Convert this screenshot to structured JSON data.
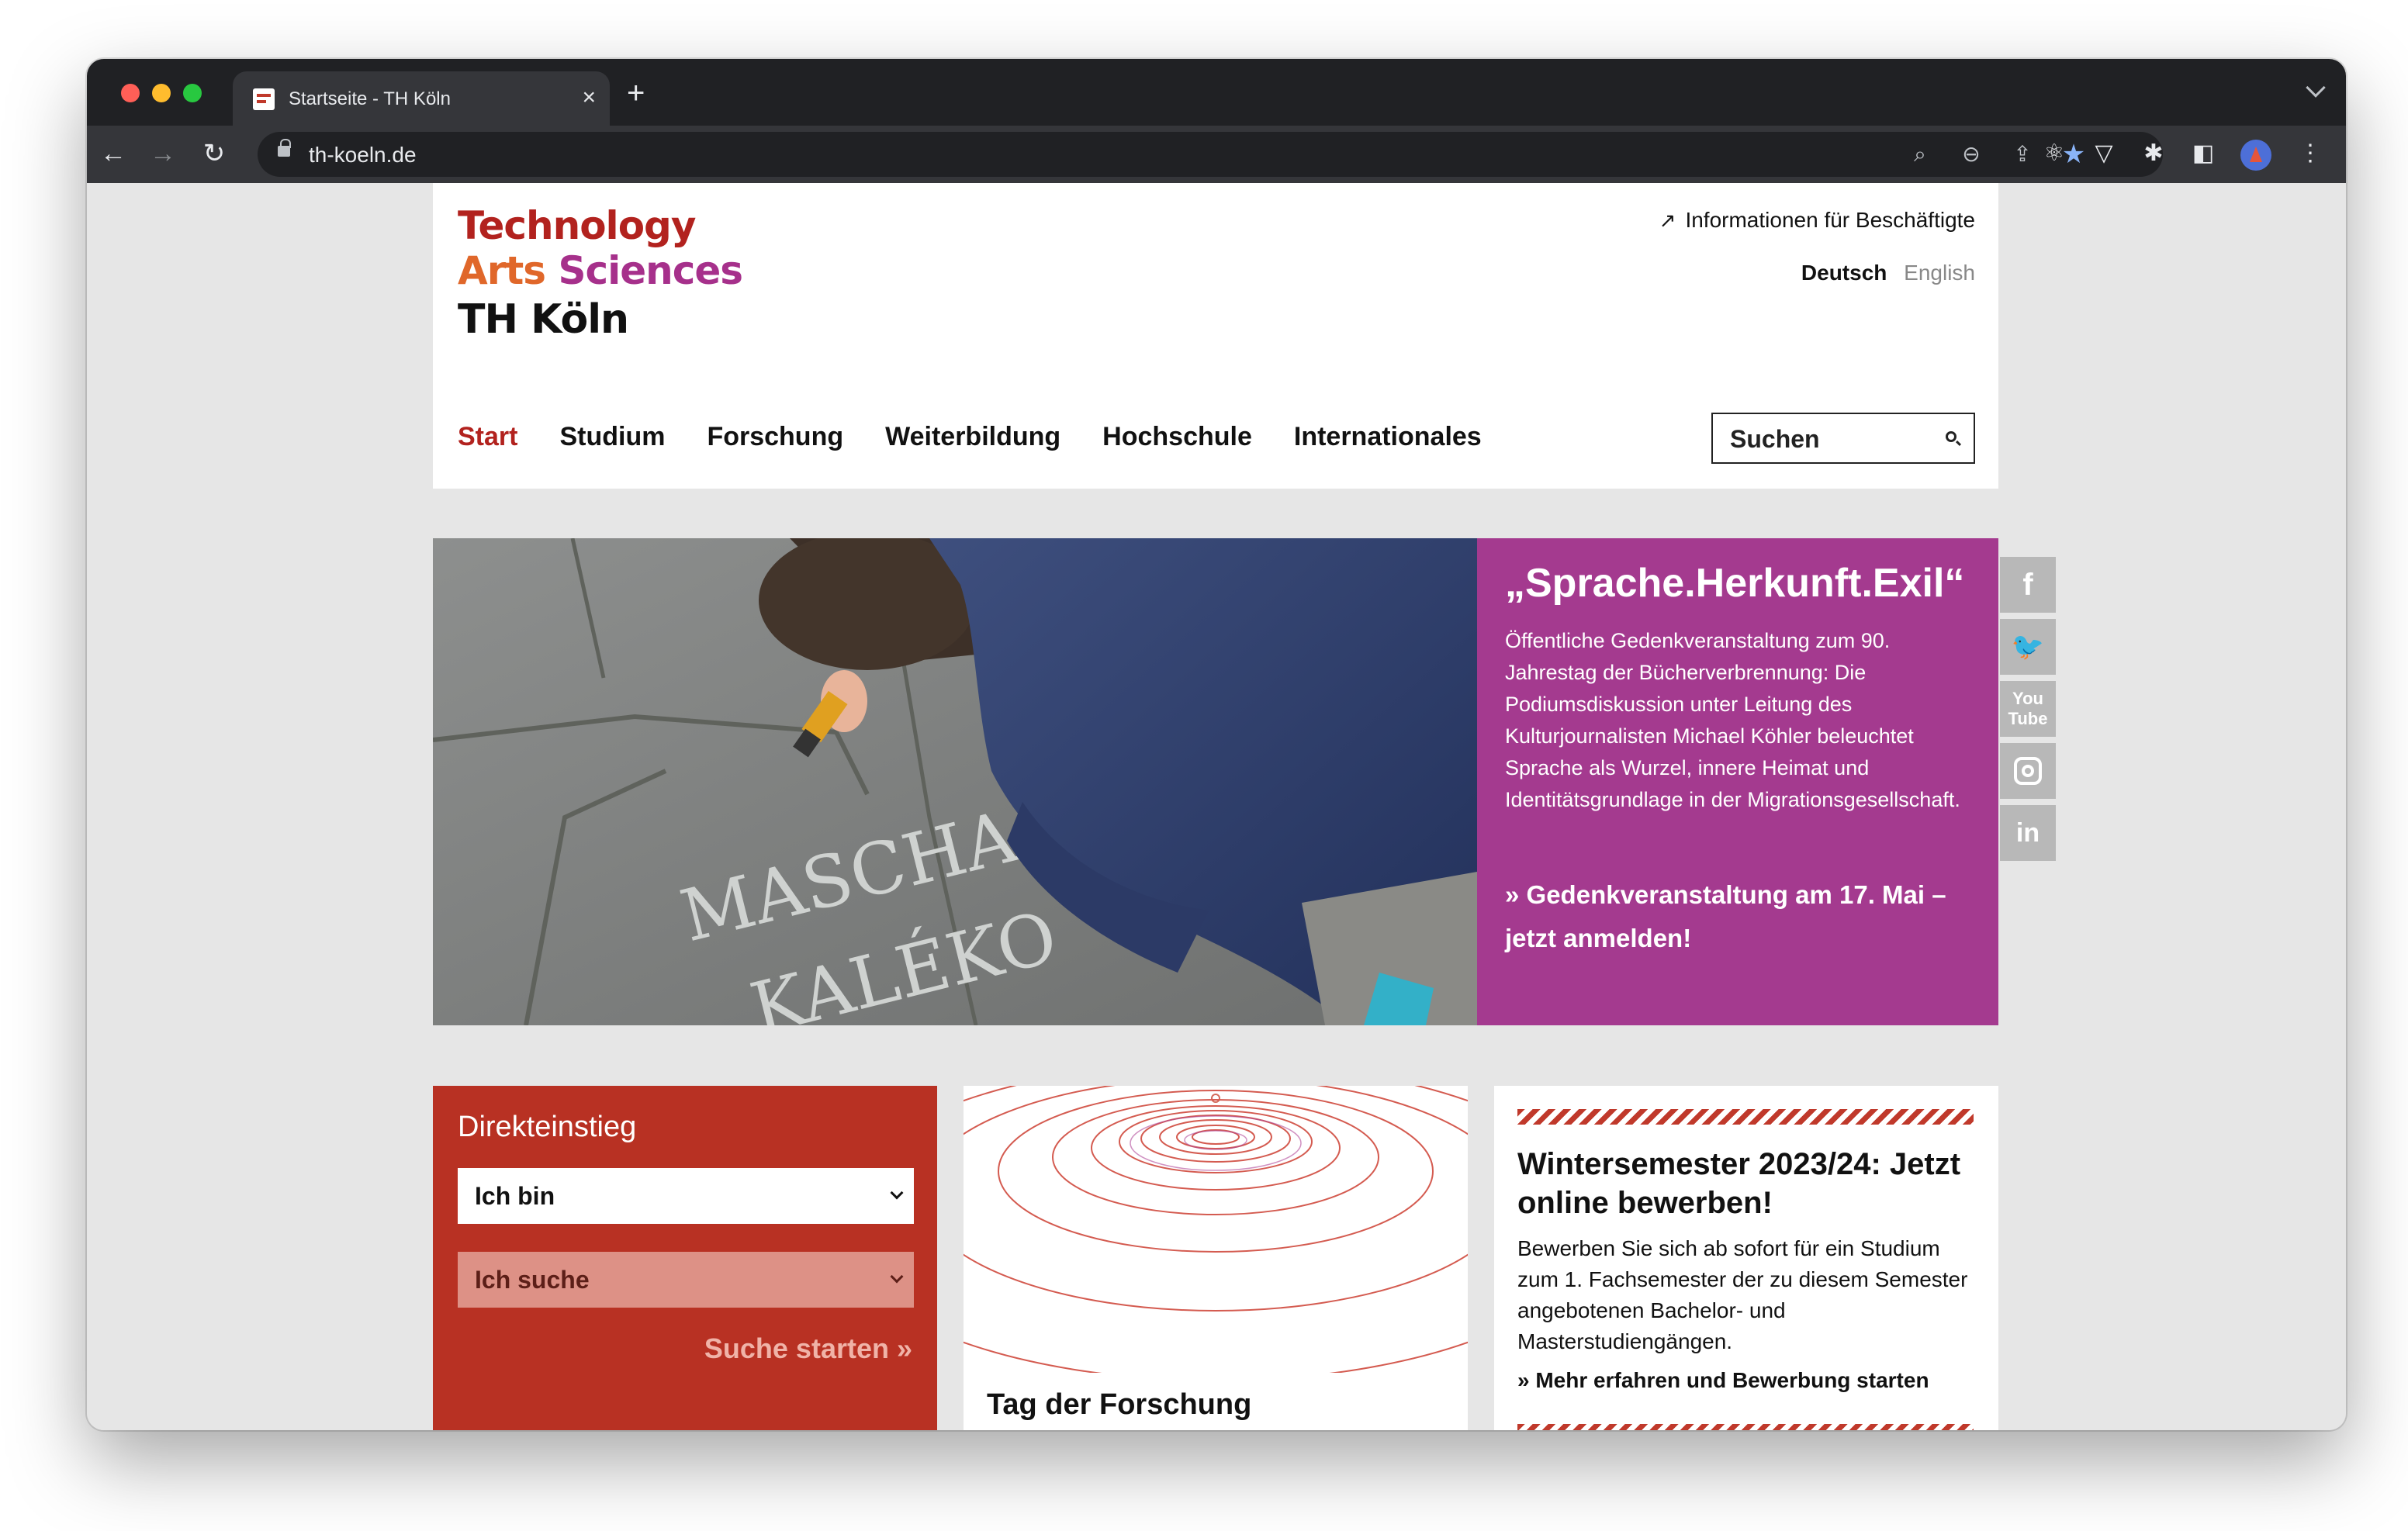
{
  "browser": {
    "tab_title": "Startseite - TH Köln",
    "url": "th-koeln.de"
  },
  "header": {
    "logo_line1": "Technology",
    "logo_arts": "Arts",
    "logo_sciences": "Sciences",
    "logo_line3": "TH Köln",
    "employee_link": "Informationen für Beschäftigte",
    "lang_de": "Deutsch",
    "lang_en": "English",
    "nav": [
      "Start",
      "Studium",
      "Forschung",
      "Weiterbildung",
      "Hochschule",
      "Internationales"
    ],
    "search_placeholder": "Suchen"
  },
  "hero": {
    "title": "„Sprache.Herkunft.Exil“",
    "text": "Öffentliche Gedenkveranstaltung zum 90. Jahrestag der Bücherverbrennung: Die Podiumsdiskussion unter Leitung des Kulturjournalisten Michael Köhler beleuchtet Sprache als Wurzel, innere Heimat und Identitätsgrundlage in der Migrationsgesellschaft.",
    "cta": "Gedenkveranstaltung am 17. Mai – jetzt anmelden!",
    "image_text_1": "MASCHA",
    "image_text_2": "KALÉKO"
  },
  "social": [
    "facebook",
    "twitter",
    "youtube",
    "instagram",
    "linkedin"
  ],
  "direkteinstieg": {
    "title": "Direkteinstieg",
    "select1": "Ich bin",
    "select2": "Ich suche",
    "cta": "Suche starten"
  },
  "research_card": {
    "title": "Tag der Forschung"
  },
  "semester_card": {
    "title": "Wintersemester 2023/24: Jetzt online bewerben!",
    "text": "Bewerben Sie sich ab sofort für ein Studium zum 1. Fachsemester der zu diesem Semester angebotenen Bachelor- und Masterstudiengängen.",
    "link": "Mehr erfahren und Bewerbung starten"
  },
  "colors": {
    "brand_red": "#b2221e",
    "brand_orange": "#e0672a",
    "brand_purple": "#a6308b",
    "hero_panel": "#a43a8f",
    "direkteinstieg_bg": "#b83123"
  }
}
